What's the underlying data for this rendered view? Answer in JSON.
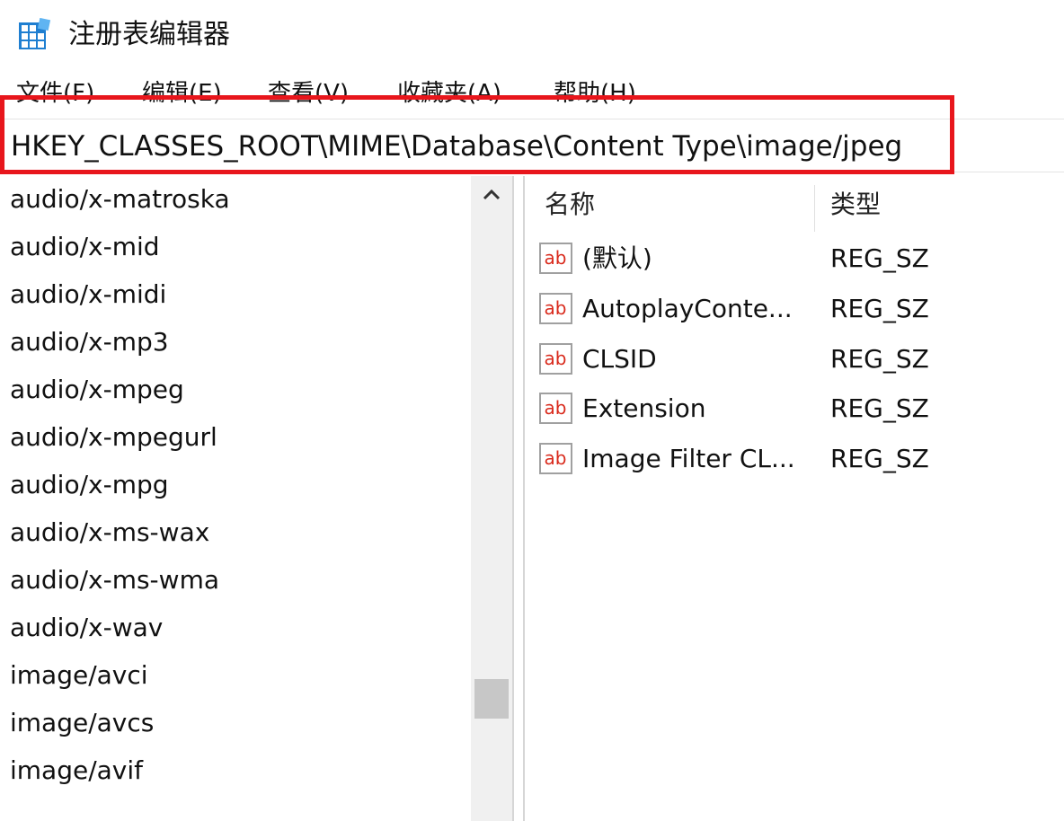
{
  "window": {
    "title": "注册表编辑器",
    "icon": "registry-editor-icon"
  },
  "menu": {
    "items": [
      "文件(F)",
      "编辑(E)",
      "查看(V)",
      "收藏夹(A)",
      "帮助(H)"
    ]
  },
  "address": {
    "value": "HKEY_CLASSES_ROOT\\MIME\\Database\\Content Type\\image/jpeg"
  },
  "colors": {
    "highlight": "#e8161c",
    "ab_icon_red": "#d92a1c"
  },
  "tree": {
    "items": [
      "audio/x-matroska",
      "audio/x-mid",
      "audio/x-midi",
      "audio/x-mp3",
      "audio/x-mpeg",
      "audio/x-mpegurl",
      "audio/x-mpg",
      "audio/x-ms-wax",
      "audio/x-ms-wma",
      "audio/x-wav",
      "image/avci",
      "image/avcs",
      "image/avif"
    ]
  },
  "list": {
    "columns": {
      "name": "名称",
      "type": "类型"
    },
    "rows": [
      {
        "name": "(默认)",
        "type": "REG_SZ",
        "icon": "string-value-icon"
      },
      {
        "name": "AutoplayConte...",
        "type": "REG_SZ",
        "icon": "string-value-icon"
      },
      {
        "name": "CLSID",
        "type": "REG_SZ",
        "icon": "string-value-icon"
      },
      {
        "name": "Extension",
        "type": "REG_SZ",
        "icon": "string-value-icon"
      },
      {
        "name": "Image Filter CL...",
        "type": "REG_SZ",
        "icon": "string-value-icon"
      }
    ]
  }
}
